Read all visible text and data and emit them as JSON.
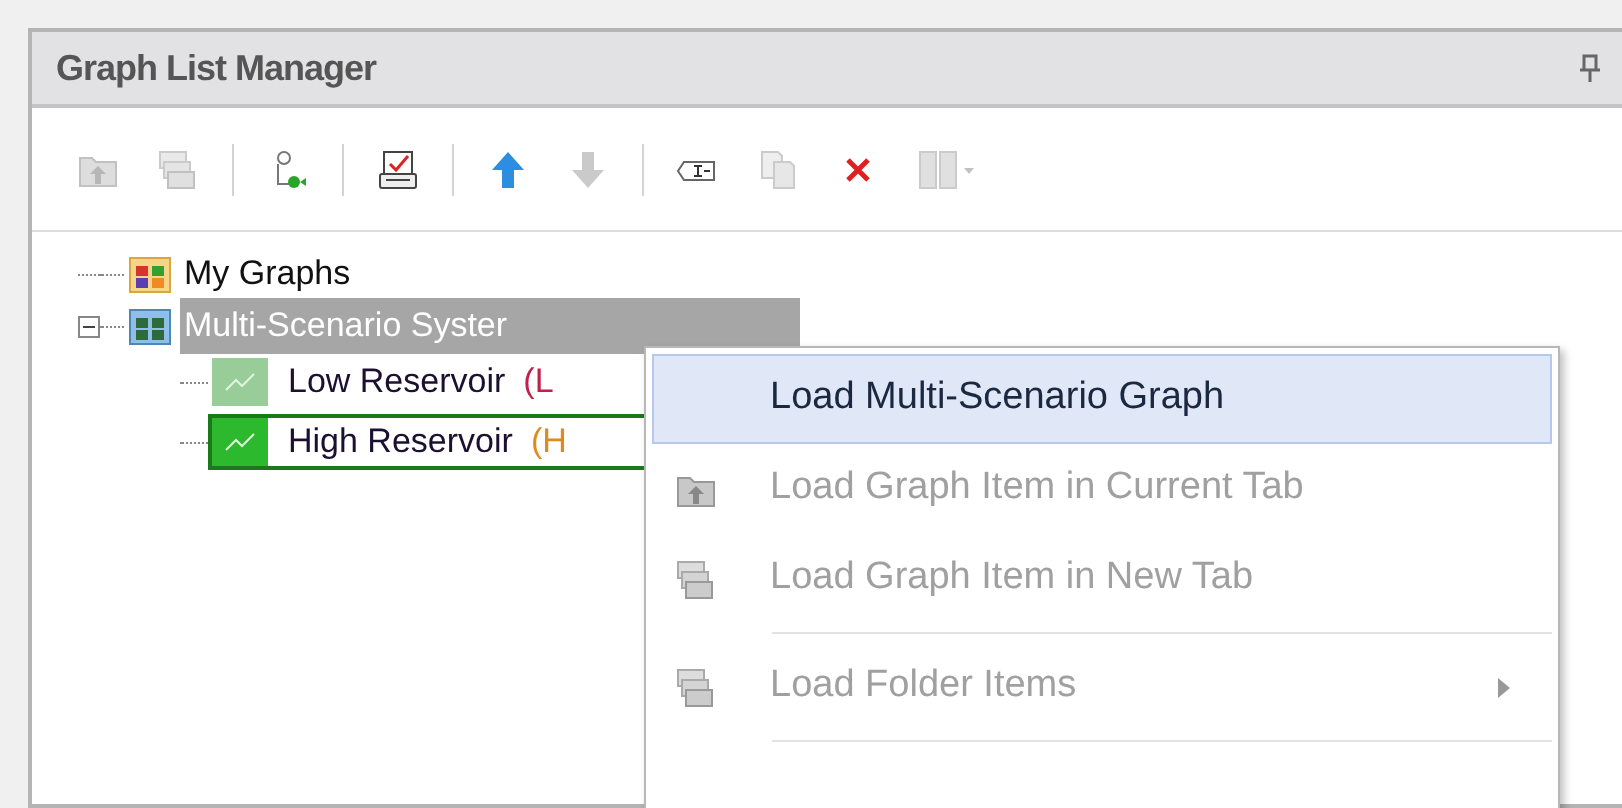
{
  "panel": {
    "title": "Graph List Manager"
  },
  "toolbar": [
    {
      "kind": "load-current",
      "disabled": true
    },
    {
      "kind": "load-new",
      "disabled": true
    },
    {
      "kind": "separator"
    },
    {
      "kind": "add",
      "disabled": false
    },
    {
      "kind": "separator"
    },
    {
      "kind": "print",
      "disabled": false
    },
    {
      "kind": "separator"
    },
    {
      "kind": "up",
      "disabled": false
    },
    {
      "kind": "down",
      "disabled": true
    },
    {
      "kind": "separator"
    },
    {
      "kind": "rename",
      "disabled": false
    },
    {
      "kind": "copy",
      "disabled": true
    },
    {
      "kind": "delete",
      "disabled": false
    },
    {
      "kind": "swap",
      "disabled": true
    }
  ],
  "tree": [
    {
      "label": "My Graphs",
      "kind": "folder",
      "selected": false
    },
    {
      "label": "Multi-Scenario Syster",
      "kind": "multi",
      "selected": true,
      "expanded": true,
      "children": [
        {
          "label": "Low Reservoir",
          "suffix": "(L",
          "color": "#c0204a",
          "selected": false,
          "focused": false
        },
        {
          "label": "High Reservoir",
          "suffix": "(H",
          "color": "#e08a1e",
          "selected": false,
          "focused": true
        }
      ]
    }
  ],
  "context_menu": [
    {
      "kind": "item",
      "label": "Load Multi-Scenario Graph",
      "disabled": false,
      "selected": true,
      "submenu": false
    },
    {
      "kind": "item",
      "label": "Load Graph Item in Current Tab",
      "disabled": true,
      "selected": false,
      "submenu": false
    },
    {
      "kind": "item",
      "label": "Load Graph Item in New Tab",
      "disabled": true,
      "selected": false,
      "submenu": false
    },
    {
      "kind": "separator"
    },
    {
      "kind": "item",
      "label": "Load Folder Items",
      "disabled": true,
      "selected": false,
      "submenu": true
    },
    {
      "kind": "separator"
    }
  ]
}
